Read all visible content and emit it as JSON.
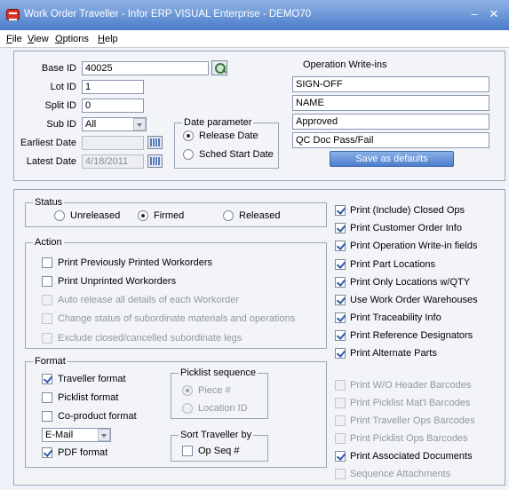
{
  "window": {
    "title": "Work Order Traveller - Infor ERP VISUAL Enterprise - DEMO70"
  },
  "menu": [
    {
      "pre": "",
      "key": "F",
      "post": "ile"
    },
    {
      "pre": "",
      "key": "V",
      "post": "iew"
    },
    {
      "pre": "",
      "key": "O",
      "post": "ptions"
    },
    {
      "pre": "",
      "key": "H",
      "post": "elp"
    }
  ],
  "form": {
    "base_id_label": "Base ID",
    "base_id": "40025",
    "lot_id_label": "Lot ID",
    "lot_id": "1",
    "split_id_label": "Split ID",
    "split_id": "0",
    "sub_id_label": "Sub ID",
    "sub_id": "All",
    "earliest_date_label": "Earliest Date",
    "earliest_date": "",
    "latest_date_label": "Latest Date",
    "latest_date": "4/18/2011"
  },
  "date_parameter": {
    "title": "Date parameter",
    "options": [
      {
        "label": "Release Date",
        "selected": true
      },
      {
        "label": "Sched Start Date",
        "selected": false
      }
    ]
  },
  "write_ins": {
    "title": "Operation Write-ins",
    "values": [
      "SIGN-OFF",
      "NAME",
      "Approved",
      "QC Doc Pass/Fail"
    ],
    "save_label": "Save as defaults"
  },
  "status": {
    "title": "Status",
    "options": [
      {
        "label": "Unreleased",
        "selected": false
      },
      {
        "label": "Firmed",
        "selected": true
      },
      {
        "label": "Released",
        "selected": false
      }
    ]
  },
  "action": {
    "title": "Action",
    "items": [
      {
        "label": "Print Previously Printed Workorders",
        "checked": false,
        "enabled": true
      },
      {
        "label": "Print Unprinted Workorders",
        "checked": false,
        "enabled": true
      },
      {
        "label": "Auto release all details of each Workorder",
        "checked": false,
        "enabled": false
      },
      {
        "label": "Change status of subordinate materials and operations",
        "checked": false,
        "enabled": false
      },
      {
        "label": "Exclude closed/cancelled subordinate legs",
        "checked": false,
        "enabled": false
      }
    ]
  },
  "format": {
    "title": "Format",
    "items": [
      {
        "label": "Traveller format",
        "checked": true
      },
      {
        "label": "Picklist format",
        "checked": false
      },
      {
        "label": "Co-product format",
        "checked": false
      }
    ],
    "output": "E-Mail",
    "pdf_label": "PDF format",
    "pdf_checked": true
  },
  "picklist_sequence": {
    "title": "Picklist sequence",
    "options": [
      {
        "label": "Piece #",
        "selected": true
      },
      {
        "label": "Location ID",
        "selected": false
      }
    ]
  },
  "sort_traveller": {
    "title": "Sort Traveller by",
    "label": "Op Seq #",
    "checked": false
  },
  "print_options": [
    {
      "label": "Print (Include) Closed Ops",
      "checked": true,
      "enabled": true
    },
    {
      "label": "Print Customer Order Info",
      "checked": true,
      "enabled": true
    },
    {
      "label": "Print Operation Write-in fields",
      "checked": true,
      "enabled": true
    },
    {
      "label": "Print Part Locations",
      "checked": true,
      "enabled": true
    },
    {
      "label": "Print Only Locations w/QTY",
      "checked": true,
      "enabled": true
    },
    {
      "label": "Use Work Order Warehouses",
      "checked": true,
      "enabled": true
    },
    {
      "label": "Print Traceability Info",
      "checked": true,
      "enabled": true
    },
    {
      "label": "Print Reference Designators",
      "checked": true,
      "enabled": true
    },
    {
      "label": "Print Alternate Parts",
      "checked": true,
      "enabled": true
    }
  ],
  "barcode_options": [
    {
      "label": "Print W/O Header Barcodes",
      "checked": false,
      "enabled": false
    },
    {
      "label": "Print Picklist Mat'l Barcodes",
      "checked": false,
      "enabled": false
    },
    {
      "label": "Print Traveller Ops Barcodes",
      "checked": false,
      "enabled": false
    },
    {
      "label": "Print Picklist Ops Barcodes",
      "checked": false,
      "enabled": false
    },
    {
      "label": "Print Associated Documents",
      "checked": true,
      "enabled": true
    },
    {
      "label": "Sequence Attachments",
      "checked": false,
      "enabled": false
    }
  ]
}
